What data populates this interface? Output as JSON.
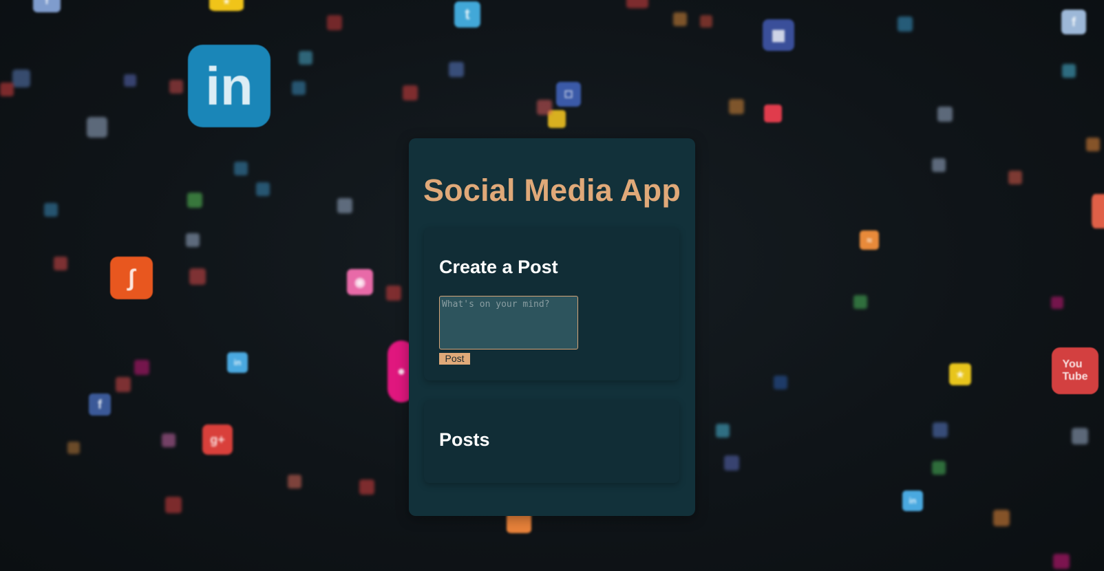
{
  "app": {
    "title": "Social Media App"
  },
  "create_post": {
    "heading": "Create a Post",
    "input_placeholder": "What's on your mind?",
    "input_value": "",
    "submit_label": "Post"
  },
  "posts": {
    "heading": "Posts",
    "items": []
  },
  "background": {
    "icons": [
      "linkedin-icon",
      "twitter-icon",
      "facebook-icon",
      "youtube-icon",
      "google-plus-icon",
      "rss-icon",
      "delicious-icon",
      "stumbleupon-icon",
      "flickr-icon"
    ]
  },
  "colors": {
    "accent": "#e0a979",
    "card_background": "#12313a",
    "section_background": "#112d36",
    "input_background": "#2d545d",
    "page_background": "#0f1418"
  }
}
